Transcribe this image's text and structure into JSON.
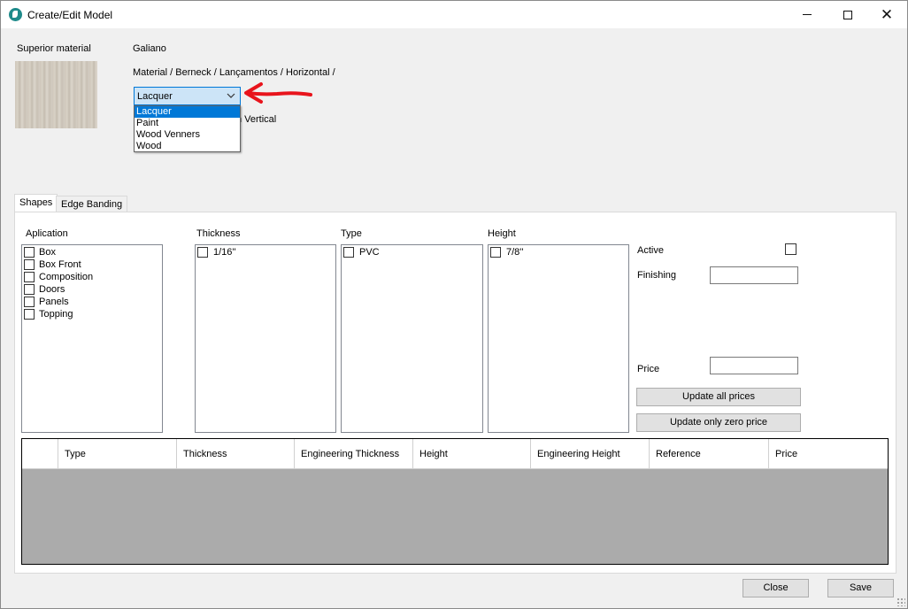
{
  "window": {
    "title": "Create/Edit Model"
  },
  "material": {
    "superior_label": "Superior material",
    "name": "Galiano",
    "breadcrumb": "Material / Berneck / Lançamentos / Horizontal /",
    "combo_value": "Lacquer",
    "options": [
      "Lacquer",
      "Paint",
      "Wood Venners",
      "Wood"
    ],
    "selected_index": 0,
    "partial_label": "n Vertical"
  },
  "tabs": [
    {
      "label": "Shapes"
    },
    {
      "label": "Edge Banding"
    }
  ],
  "groups": {
    "aplication": {
      "label": "Aplication",
      "items": [
        "Box",
        "Box Front",
        "Composition",
        "Doors",
        "Panels",
        "Topping"
      ]
    },
    "thickness": {
      "label": "Thickness",
      "items": [
        "1/16''"
      ]
    },
    "type": {
      "label": "Type",
      "items": [
        "PVC"
      ]
    },
    "height": {
      "label": "Height",
      "items": [
        "7/8''"
      ]
    }
  },
  "side": {
    "active_label": "Active",
    "finishing_label": "Finishing",
    "price_label": "Price",
    "finishing_value": "",
    "price_value": "",
    "update_all": "Update all prices",
    "update_zero": "Update only zero price"
  },
  "grid": {
    "columns": [
      "",
      "Type",
      "Thickness",
      "Engineering Thickness",
      "Height",
      "Engineering Height",
      "Reference",
      "Price"
    ]
  },
  "footer": {
    "close": "Close",
    "save": "Save"
  },
  "colors": {
    "accent": "#0078d7",
    "arrow": "#e8141c",
    "grid_empty": "#ababab"
  }
}
